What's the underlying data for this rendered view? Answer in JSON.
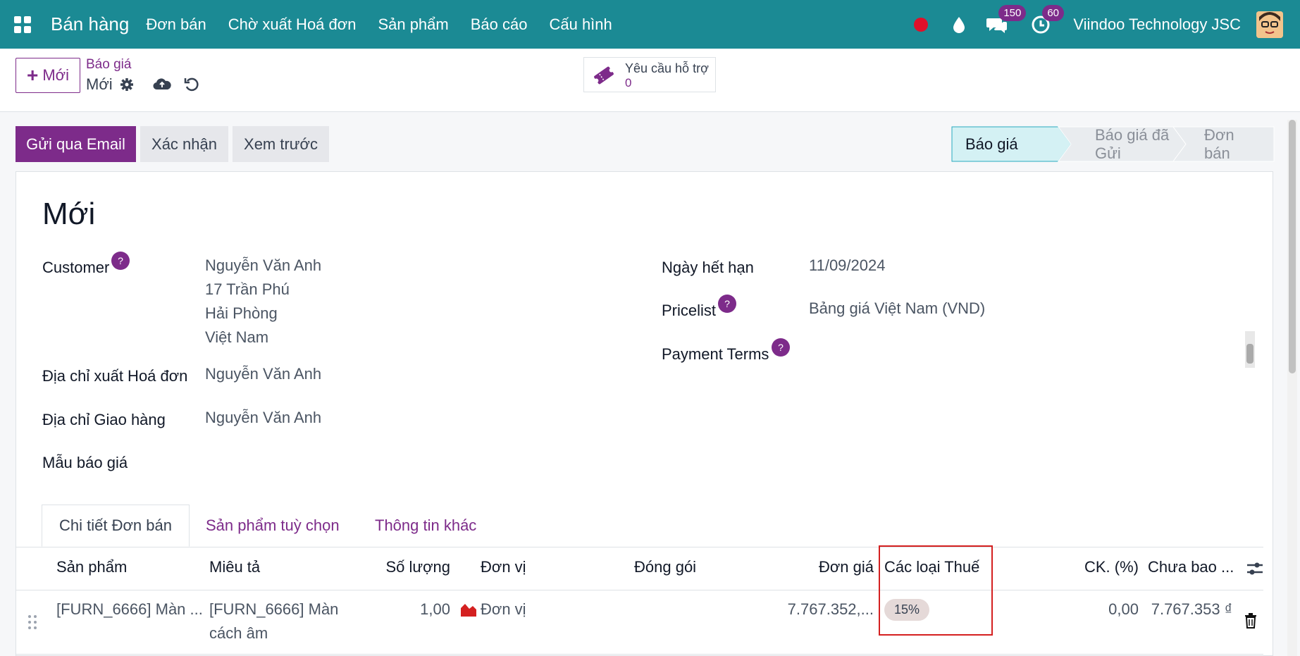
{
  "topbar": {
    "app_name": "Bán hàng",
    "menu": [
      "Đơn bán",
      "Chờ xuất Hoá đơn",
      "Sản phẩm",
      "Báo cáo",
      "Cấu hình"
    ],
    "messages_count": "150",
    "activities_count": "60",
    "company": "Viindoo Technology JSC",
    "status_color": "#e0102a"
  },
  "control": {
    "new_label": "Mới",
    "breadcrumb_parent": "Báo giá",
    "breadcrumb_current": "Mới",
    "support_label": "Yêu cầu hỗ trợ",
    "support_count": "0"
  },
  "actions": {
    "send_email": "Gửi qua Email",
    "confirm": "Xác nhận",
    "preview": "Xem trước"
  },
  "status_steps": [
    "Báo giá",
    "Báo giá đã Gửi",
    "Đơn bán"
  ],
  "status_active": "Báo giá",
  "form": {
    "title": "Mới",
    "customer_label": "Customer",
    "customer_name": "Nguyễn Văn Anh",
    "customer_address": [
      "17 Trần Phú",
      "Hải Phòng",
      "Việt Nam"
    ],
    "invoice_address_label": "Địa chỉ xuất Hoá đơn",
    "invoice_address": "Nguyễn Văn Anh",
    "delivery_address_label": "Địa chỉ Giao hàng",
    "delivery_address": "Nguyễn Văn Anh",
    "template_label": "Mẫu báo giá",
    "expiry_label": "Ngày hết hạn",
    "expiry": "11/09/2024",
    "pricelist_label": "Pricelist",
    "pricelist": "Bảng giá Việt Nam (VND)",
    "payment_terms_label": "Payment Terms",
    "help_mark": "?"
  },
  "tabs": [
    "Chi tiết Đơn bán",
    "Sản phẩm tuỳ chọn",
    "Thông tin khác"
  ],
  "table": {
    "headers": {
      "product": "Sản phẩm",
      "description": "Miêu tả",
      "quantity": "Số lượng",
      "uom": "Đơn vị",
      "packaging": "Đóng gói",
      "price": "Đơn giá",
      "taxes": "Các loại Thuế",
      "discount": "CK. (%)",
      "subtotal": "Chưa bao ..."
    },
    "row": {
      "product": "[FURN_6666] Màn ...",
      "description_line1": "[FURN_6666] Màn",
      "description_line2": "cách âm",
      "quantity": "1,00",
      "uom": "Đơn vị",
      "price": "7.767.352,...",
      "tax": "15%",
      "discount": "0,00",
      "subtotal": "7.767.353 ₫"
    }
  }
}
